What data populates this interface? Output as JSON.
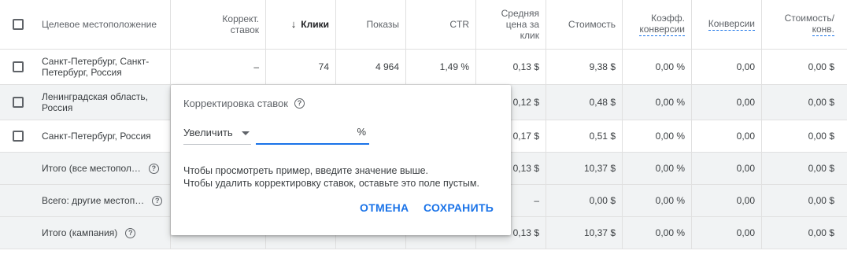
{
  "header": {
    "location": "Целевое местоположение",
    "bid_adj_line1": "Коррект.",
    "bid_adj_line2": "ставок",
    "clicks": "Клики",
    "impressions": "Показы",
    "ctr": "CTR",
    "avg_cpc_line1": "Средняя",
    "avg_cpc_line2": "цена за",
    "avg_cpc_line3": "клик",
    "cost": "Стоимость",
    "conv_rate_line1": "Коэфф.",
    "conv_rate_line2": "конверсии",
    "conversions": "Конверсии",
    "cost_conv_line1": "Стоимость/",
    "cost_conv_line2": "конв."
  },
  "rows": [
    {
      "location_line1": "Санкт-Петербург, Санкт-",
      "location_line2": "Петербург, Россия",
      "bid_adj": "–",
      "clicks": "74",
      "impressions": "4 964",
      "ctr": "1,49 %",
      "avg_cpc": "0,13 $",
      "cost": "9,38 $",
      "conv_rate": "0,00 %",
      "conversions": "0,00",
      "cost_conv": "0,00 $"
    },
    {
      "location_line1": "Ленинградская область,",
      "location_line2": "Россия",
      "avg_cpc": "0,12 $",
      "cost": "0,48 $",
      "conv_rate": "0,00 %",
      "conversions": "0,00",
      "cost_conv": "0,00 $"
    },
    {
      "location_line1": "Санкт-Петербург, Россия",
      "avg_cpc": "0,17 $",
      "cost": "0,51 $",
      "conv_rate": "0,00 %",
      "conversions": "0,00",
      "cost_conv": "0,00 $"
    }
  ],
  "totals": [
    {
      "label": "Итого (все местопол…",
      "avg_cpc": "0,13 $",
      "cost": "10,37 $",
      "conv_rate": "0,00 %",
      "conversions": "0,00",
      "cost_conv": "0,00 $"
    },
    {
      "label": "Всего: другие местоп…",
      "avg_cpc": "–",
      "cost": "0,00 $",
      "conv_rate": "0,00 %",
      "conversions": "0,00",
      "cost_conv": "0,00 $"
    },
    {
      "label": "Итого (кампания)",
      "avg_cpc": "0,13 $",
      "cost": "10,37 $",
      "conv_rate": "0,00 %",
      "conversions": "0,00",
      "cost_conv": "0,00 $"
    }
  ],
  "popup": {
    "title": "Корректировка ставок",
    "select_value": "Увеличить",
    "input_value": "",
    "suffix": "%",
    "hint_line1": "Чтобы просмотреть пример, введите значение выше.",
    "hint_line2": "Чтобы удалить корректировку ставок, оставьте это поле пустым.",
    "cancel_label": "ОТМЕНА",
    "save_label": "СОХРАНИТЬ"
  },
  "icons": {
    "help": "help-circle-icon",
    "sort": "arrow-down-icon",
    "dropdown": "caret-down-icon"
  },
  "colors": {
    "accent": "#1a73e8",
    "row_highlight": "#f1f3f4",
    "text": "#3c4043"
  }
}
